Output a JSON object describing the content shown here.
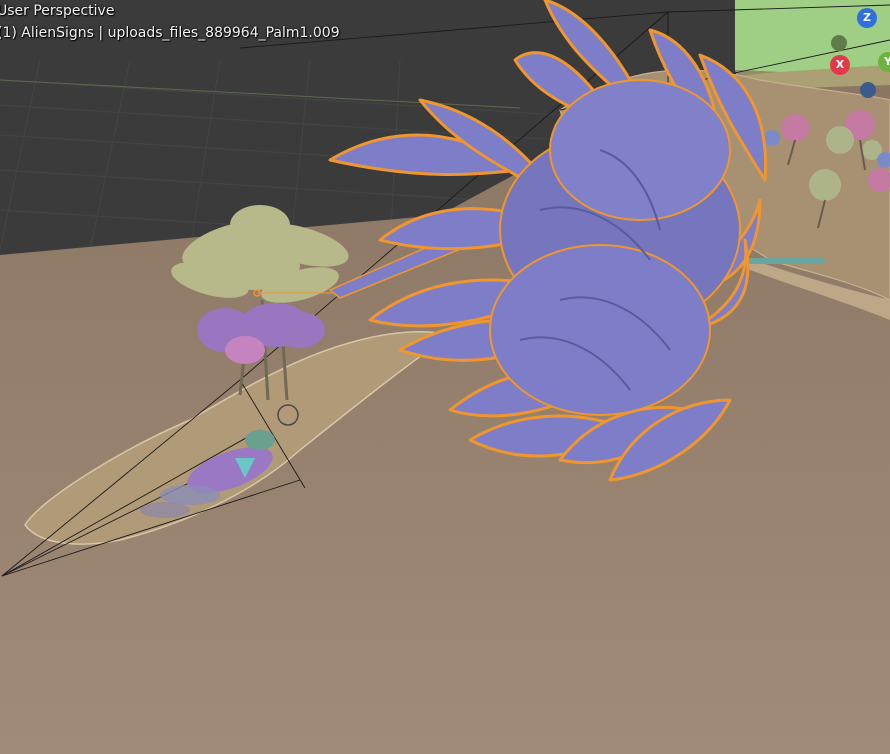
{
  "viewport": {
    "view_name": "User Perspective",
    "object_info": "(1) AlienSigns | uploads_files_889964_Palm1.009"
  },
  "gizmo": {
    "axes": [
      {
        "name": "z",
        "label": "Z",
        "color": "#2f6fde"
      },
      {
        "name": "x",
        "label": "X",
        "color": "#e23a4a"
      },
      {
        "name": "y",
        "label": "Y",
        "color": "#6cb33f"
      }
    ],
    "negative_axes": [
      {
        "name": "neg-y",
        "color": "#5f7d4a"
      },
      {
        "name": "neg-z",
        "color": "#3d5a8c"
      }
    ]
  },
  "colors": {
    "background_grid": "#3c3c3c",
    "ground": "#8e7a68",
    "sand_island": "#b09a78",
    "selection_outline": "#f0962e",
    "palm_leaves_selected": "#7d7ec7",
    "palm_leaves_yellow": "#b7b98a",
    "palm_leaves_purple": "#9a76c0"
  }
}
